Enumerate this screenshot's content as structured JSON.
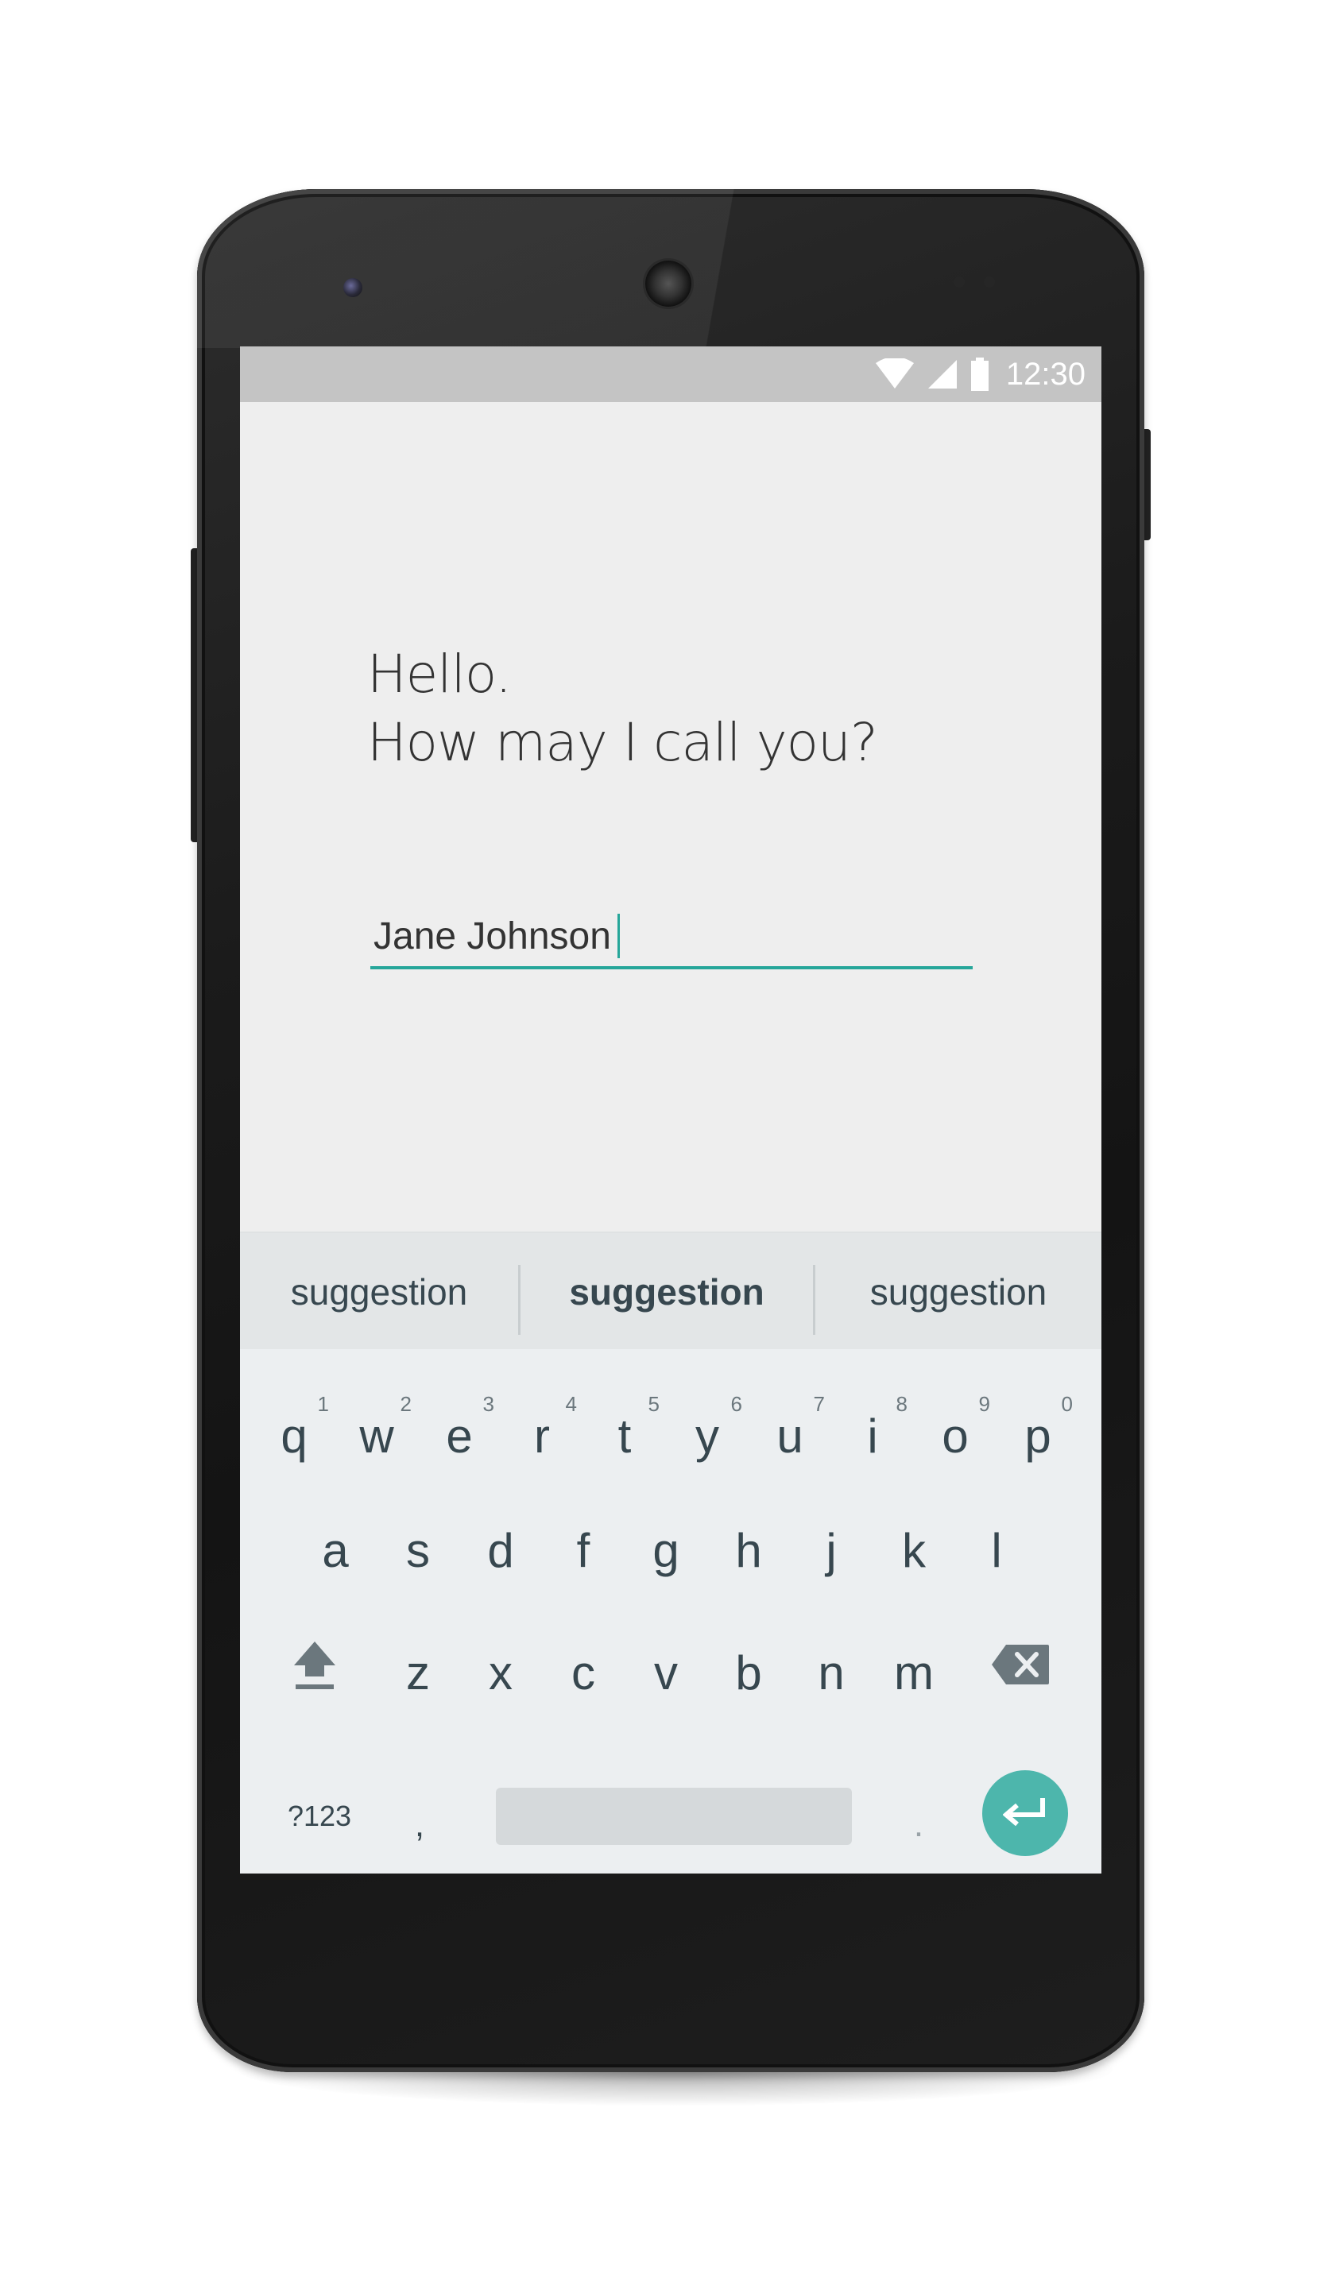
{
  "status_bar": {
    "time": "12:30",
    "icons": [
      "wifi-icon",
      "cellular-signal-icon",
      "battery-icon"
    ],
    "background": "#c4c4c4"
  },
  "greeting": {
    "line1": "Hello.",
    "line2": "How may I call you?"
  },
  "name_input": {
    "value": "Jane Johnson",
    "underline_color": "#26a69a"
  },
  "suggestions": [
    "suggestion",
    "suggestion",
    "suggestion"
  ],
  "keyboard": {
    "row1": [
      {
        "letter": "q",
        "hint": "1"
      },
      {
        "letter": "w",
        "hint": "2"
      },
      {
        "letter": "e",
        "hint": "3"
      },
      {
        "letter": "r",
        "hint": "4"
      },
      {
        "letter": "t",
        "hint": "5"
      },
      {
        "letter": "y",
        "hint": "6"
      },
      {
        "letter": "u",
        "hint": "7"
      },
      {
        "letter": "i",
        "hint": "8"
      },
      {
        "letter": "o",
        "hint": "9"
      },
      {
        "letter": "p",
        "hint": "0"
      }
    ],
    "row2": [
      "a",
      "s",
      "d",
      "f",
      "g",
      "h",
      "j",
      "k",
      "l"
    ],
    "row3": [
      "z",
      "x",
      "c",
      "v",
      "b",
      "n",
      "m"
    ],
    "symbols_label": "?123",
    "comma": ",",
    "period": ".",
    "shift_icon": "shift-arrow-icon",
    "backspace_icon": "backspace-icon",
    "enter_icon": "enter-arrow-icon",
    "enter_color": "#4db6ac"
  }
}
